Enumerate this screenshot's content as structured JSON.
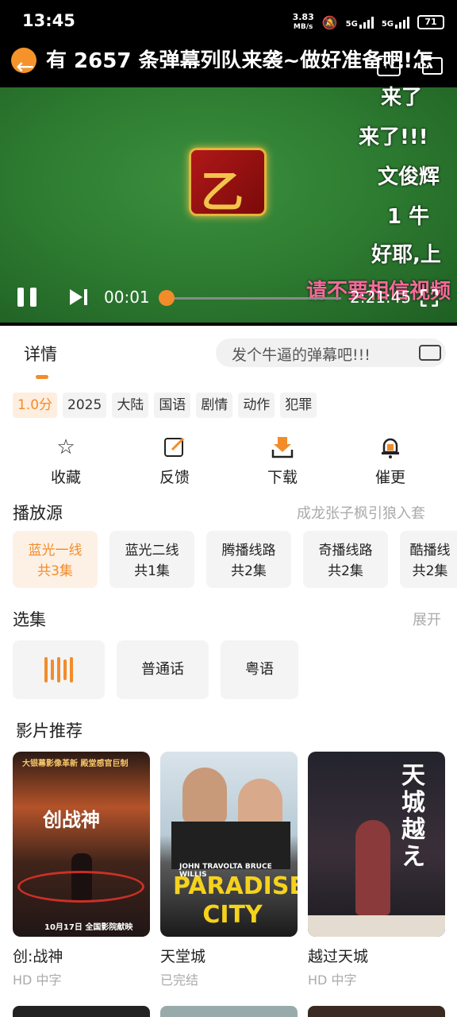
{
  "status_bar": {
    "time": "13:45",
    "net_speed_value": "3.83",
    "net_speed_unit": "MB/s",
    "signal_1": "5G",
    "signal_2": "5G",
    "battery": "71",
    "icons": [
      "mute-bell-icon",
      "signal-icon",
      "battery-icon"
    ]
  },
  "player": {
    "marquee": "有 2657 条弹幕列队来袭~做好准备吧!怎",
    "tv_label": "TV",
    "danmu": [
      {
        "text": "来了"
      },
      {
        "text": "来了!!!"
      },
      {
        "text": "文俊辉"
      },
      {
        "text": "1 牛"
      },
      {
        "text": "好耶,上"
      },
      {
        "text": "请不要相信视频"
      }
    ],
    "current_time": "00:01",
    "total_time": "2:21:45",
    "progress_fraction": 0.0001,
    "accent": "#f28c2a"
  },
  "tabs": {
    "detail": "详情",
    "danmu_placeholder": "发个牛逼的弹幕吧!!!"
  },
  "tags": [
    "1.0分",
    "2025",
    "大陆",
    "国语",
    "剧情",
    "动作",
    "犯罪"
  ],
  "actions": [
    {
      "label": "收藏",
      "icon": "star-icon"
    },
    {
      "label": "反馈",
      "icon": "edit-icon"
    },
    {
      "label": "下载",
      "icon": "download-icon"
    },
    {
      "label": "催更",
      "icon": "bell-icon"
    }
  ],
  "sources": {
    "title": "播放源",
    "right_text": "成龙张子枫引狼入套",
    "items": [
      {
        "name": "蓝光一线",
        "count": "共3集"
      },
      {
        "name": "蓝光二线",
        "count": "共1集"
      },
      {
        "name": "腾播线路",
        "count": "共2集"
      },
      {
        "name": "奇播线路",
        "count": "共2集"
      },
      {
        "name": "酷播线",
        "count": "共2集"
      }
    ]
  },
  "episodes": {
    "title": "选集",
    "expand": "展开",
    "items": [
      "普通话",
      "粤语"
    ]
  },
  "recommend": {
    "title": "影片推荐",
    "movies": [
      {
        "title": "创:战神",
        "sub": "HD 中字",
        "poster_text": "创战神",
        "poster_top": "大银幕影像革新 殿堂感官巨制",
        "poster_bottom": "10月17日 全国影院献映"
      },
      {
        "title": "天堂城",
        "sub": "已完结",
        "poster_text": "PARADISE CITY",
        "poster_top": "JOHN TRAVOLTA  BRUCE WILLIS"
      },
      {
        "title": "越过天城",
        "sub": "HD 中字",
        "poster_text": "天城越え"
      }
    ]
  }
}
